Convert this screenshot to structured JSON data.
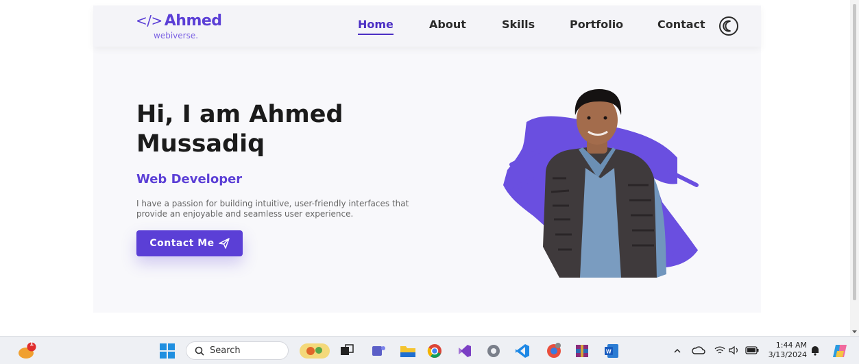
{
  "site": {
    "logo_text": "Ahmed",
    "logo_code": "</>",
    "logo_sub": "webiverse.",
    "nav": [
      "Home",
      "About",
      "Skills",
      "Portfolio",
      "Contact"
    ],
    "active_nav": "Home"
  },
  "hero": {
    "title_line1": "Hi, I am Ahmed",
    "title_line2": "Mussadiq",
    "role": "Web Developer",
    "description": "I have a passion for building intuitive, user-friendly interfaces that provide an enjoyable and seamless user experience.",
    "cta_label": "Contact Me"
  },
  "taskbar": {
    "search_placeholder": "Search",
    "notification_count": "1",
    "time": "1:44 AM",
    "date": "3/13/2024"
  },
  "colors": {
    "accent": "#5b3fd6",
    "text_dark": "#1b1b1b",
    "taskbar": "#eef0f4"
  },
  "icons": [
    "code-icon",
    "moon-icon",
    "send-icon",
    "windows-start-icon",
    "search-icon",
    "task-view-icon",
    "teams-icon",
    "file-explorer-icon",
    "chrome-icon",
    "visual-studio-icon",
    "settings-icon",
    "vscode-icon",
    "browser-icon",
    "winrar-icon",
    "word-icon",
    "chevron-up-icon",
    "onedrive-icon",
    "wifi-icon",
    "volume-icon",
    "battery-icon",
    "bell-icon",
    "copilot-icon"
  ]
}
